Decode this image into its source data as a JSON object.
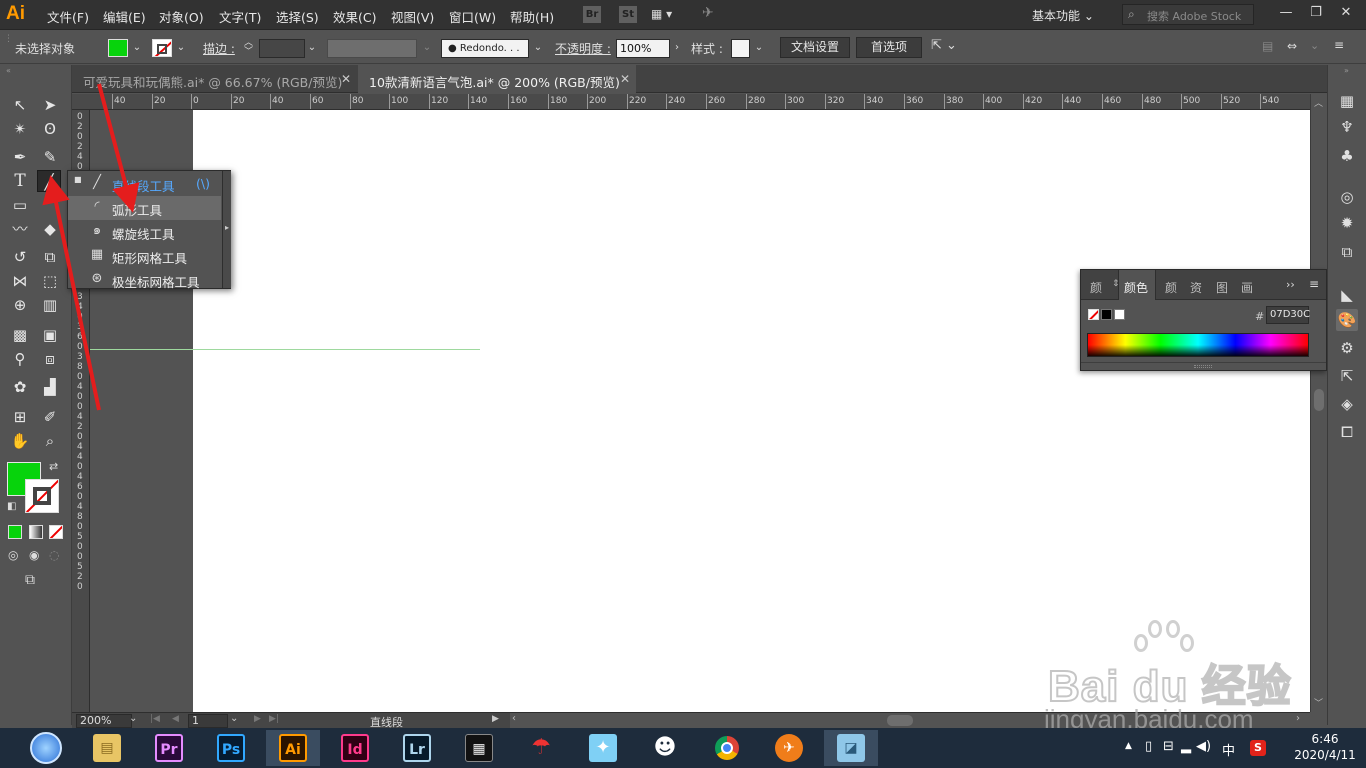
{
  "app": {
    "logo": "Ai"
  },
  "menu": [
    "文件(F)",
    "编辑(E)",
    "对象(O)",
    "文字(T)",
    "选择(S)",
    "效果(C)",
    "视图(V)",
    "窗口(W)",
    "帮助(H)"
  ],
  "menubar_icons": [
    "Br",
    "St"
  ],
  "workspace_label": "基本功能",
  "stock_search_placeholder": "搜索 Adobe Stock",
  "window_controls": [
    "—",
    "❐",
    "✕"
  ],
  "control_bar": {
    "selection_label": "未选择对象",
    "stroke_label": "描边 :",
    "brush_label": "Redondo. . .",
    "opacity_label": "不透明度 :",
    "opacity_value": "100%",
    "style_label": "样式 :",
    "doc_settings_button": "文档设置",
    "preferences_button": "首选项"
  },
  "tabs": [
    {
      "title": "可爱玩具和玩偶熊.ai* @ 66.67% (RGB/预览)",
      "active": false
    },
    {
      "title": "10款清新语言气泡.ai* @ 200% (RGB/预览)",
      "active": true
    }
  ],
  "ruler_top_labels": [
    "40",
    "20",
    "0",
    "20",
    "40",
    "60",
    "80",
    "100",
    "120",
    "140",
    "160",
    "180",
    "200",
    "220",
    "240",
    "260",
    "280",
    "300",
    "320",
    "340",
    "360",
    "380",
    "400",
    "420",
    "440",
    "460",
    "480",
    "500",
    "520",
    "540"
  ],
  "ruler_left_labels": [
    "0",
    "2",
    "0",
    "2",
    "4",
    "0",
    "2",
    "6",
    "0",
    "2",
    "8",
    "0",
    "3",
    "0",
    "0",
    "3",
    "2",
    "0",
    "3",
    "4",
    "0",
    "3",
    "6",
    "0",
    "3",
    "8",
    "0",
    "4",
    "0",
    "0",
    "4",
    "2",
    "0",
    "4",
    "4",
    "0",
    "4",
    "6",
    "0",
    "4",
    "8",
    "0",
    "5",
    "0",
    "0",
    "5",
    "2",
    "0"
  ],
  "flyout": {
    "items": [
      {
        "label": "直线段工具",
        "shortcut": "(\\)",
        "icon": "line-segment-icon",
        "selected": true
      },
      {
        "label": "弧形工具",
        "shortcut": "",
        "icon": "arc-icon",
        "selected": false
      },
      {
        "label": "螺旋线工具",
        "shortcut": "",
        "icon": "spiral-icon",
        "selected": false
      },
      {
        "label": "矩形网格工具",
        "shortcut": "",
        "icon": "rect-grid-icon",
        "selected": false
      },
      {
        "label": "极坐标网格工具",
        "shortcut": "",
        "icon": "polar-grid-icon",
        "selected": false
      }
    ]
  },
  "color_panel": {
    "tabs": [
      "颜",
      "颜色",
      "颜",
      "资",
      "图",
      "画"
    ],
    "active_tab": "颜色",
    "hex_symbol": "#",
    "hex_value": "07D30C"
  },
  "colors": {
    "fill": "#07d30c",
    "accent_orange": "#ff9a00",
    "guide": "#9ed99e"
  },
  "status_bar": {
    "zoom": "200%",
    "artboard_number": "1",
    "current_tool": "直线段"
  },
  "taskbar": {
    "apps": [
      "Pr",
      "Ps",
      "Ai",
      "Id",
      "Lr"
    ],
    "tray_ime": "中",
    "time": "6:46",
    "date": "2020/4/11"
  },
  "watermark": {
    "brand": "Bai du 经验",
    "url": "jingyan.baidu.com"
  }
}
